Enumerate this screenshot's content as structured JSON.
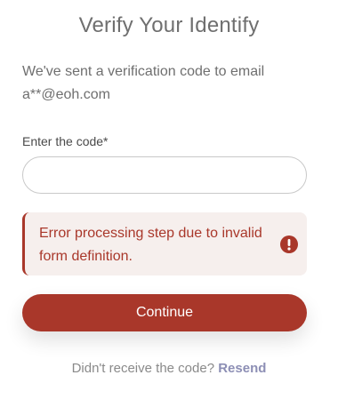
{
  "title": "Verify Your Identify",
  "description": {
    "line1": "We've sent a verification code to email",
    "line2": "a**@eoh.com"
  },
  "code_field": {
    "label": "Enter the code*",
    "value": "",
    "placeholder": ""
  },
  "error": {
    "message": "Error processing step due to invalid form definition.",
    "icon": "exclamation-circle-icon",
    "color": "#a9372a",
    "background": "#f6efed"
  },
  "continue_button": {
    "label": "Continue",
    "color": "#a9372a"
  },
  "resend": {
    "prompt": "Didn't receive the code?",
    "link_label": "Resend",
    "link_color": "#8d8fb5"
  }
}
